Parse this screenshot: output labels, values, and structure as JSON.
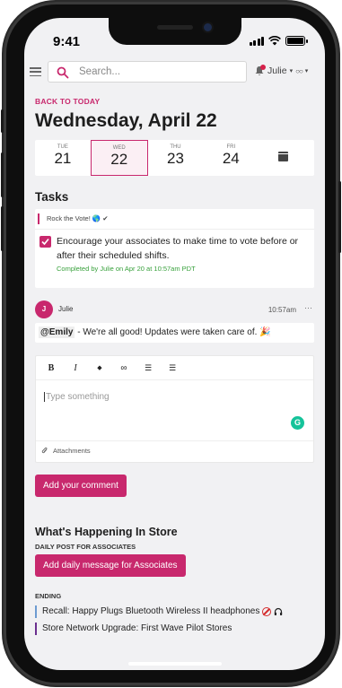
{
  "status_bar": {
    "time": "9:41"
  },
  "top_bar": {
    "search_placeholder": "Search...",
    "user_name": "Julie"
  },
  "date_nav": {
    "back_label": "BACK TO TODAY",
    "title": "Wednesday, April 22",
    "days": [
      {
        "name": "TUE",
        "date": "21"
      },
      {
        "name": "WED",
        "date": "22"
      },
      {
        "name": "THU",
        "date": "23"
      },
      {
        "name": "FRI",
        "date": "24"
      }
    ],
    "calendar_icon": "calendar-icon"
  },
  "tasks": {
    "heading": "Tasks",
    "tag": "Rock the Vote! 🌎 ✔",
    "text": "Encourage your associates to make time to vote before or after their scheduled shifts.",
    "completed_text": "Completed by Julie on Apr 20 at 10:57am PDT"
  },
  "comment": {
    "avatar_initial": "J",
    "author": "Julie",
    "time": "10:57am",
    "more": "···",
    "mention": "@Emily",
    "body": " - We're all good! Updates were taken care of. 🎉"
  },
  "editor": {
    "toolbar": {
      "bold": "B",
      "italic": "I",
      "color": "◆",
      "link": "∞",
      "ordered_list": "☰",
      "bullet_list": "☰"
    },
    "placeholder": "Type something",
    "attachments_label": "Attachments",
    "submit_label": "Add your comment"
  },
  "store": {
    "heading": "What's Happening In Store",
    "daily_label": "DAILY POST FOR ASSOCIATES",
    "add_daily_label": "Add daily message for Associates",
    "ending_label": "ENDING",
    "ending_items": [
      "Recall: Happy Plugs Bluetooth Wireless II headphones",
      "Store Network Upgrade: First Wave Pilot Stores"
    ]
  },
  "colors": {
    "accent": "#c8286d",
    "success": "#38a13c",
    "ending_blue": "#6d9bd1",
    "ending_purple": "#6b2f8f"
  }
}
